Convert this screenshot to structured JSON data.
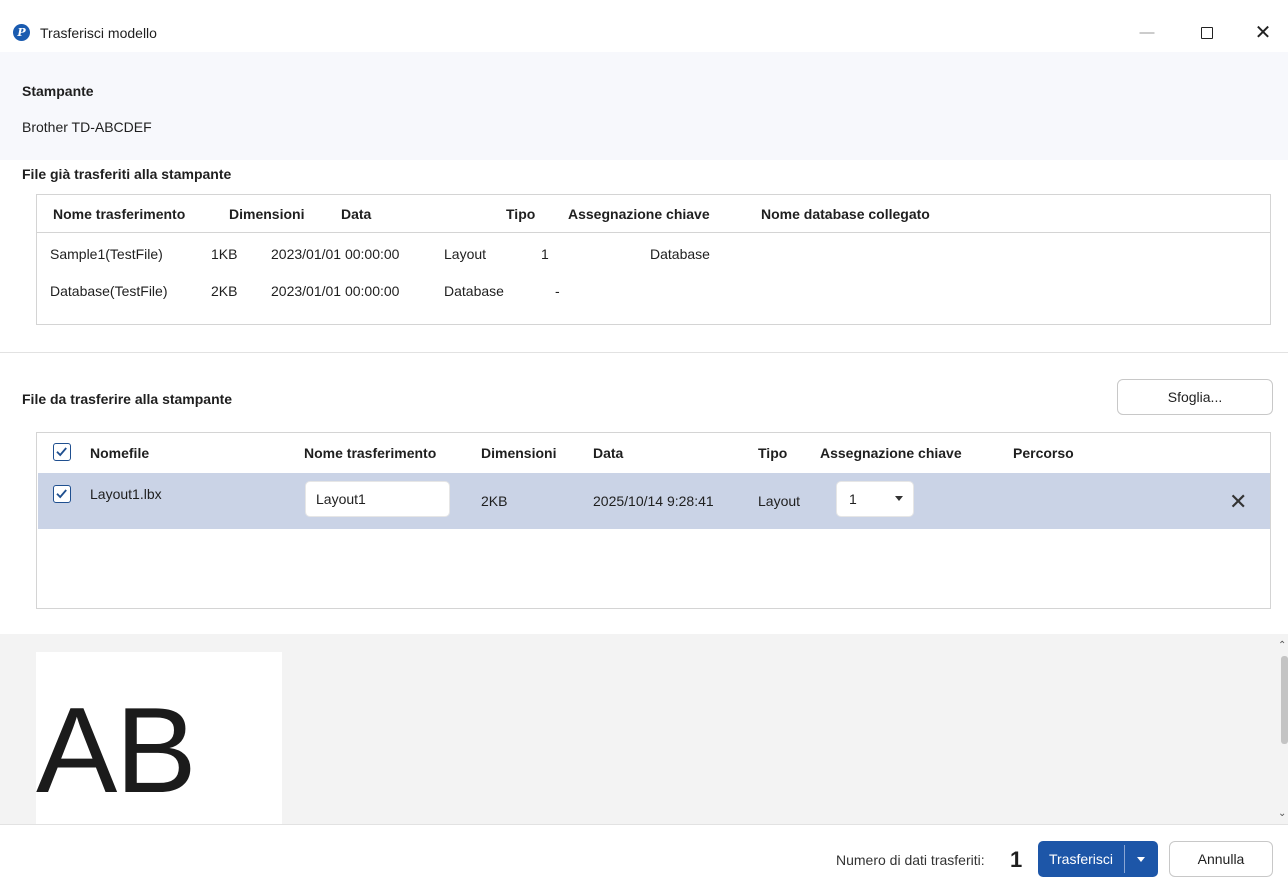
{
  "window": {
    "title": "Trasferisci modello",
    "minimize_glyph": "—",
    "close_glyph": "✕",
    "icon": "brother-p-logo-icon"
  },
  "printer": {
    "label": "Stampante",
    "name": "Brother TD-ABCDEF"
  },
  "transferred": {
    "label": "File già trasferiti alla stampante",
    "headers": {
      "name": "Nome trasferimento",
      "size": "Dimensioni",
      "date": "Data",
      "type": "Tipo",
      "key": "Assegnazione chiave",
      "db": "Nome database collegato"
    },
    "rows": [
      {
        "name": "Sample1(TestFile)",
        "size": "1KB",
        "date": "2023/01/01 00:00:00",
        "type": "Layout",
        "key": "1",
        "db": "Database"
      },
      {
        "name": "Database(TestFile)",
        "size": "2KB",
        "date": "2023/01/01 00:00:00",
        "type": "Database",
        "key": "-",
        "db": ""
      }
    ]
  },
  "to_transfer": {
    "label": "File da trasferire alla stampante",
    "browse_label": "Sfoglia...",
    "headers": {
      "filename": "Nomefile",
      "name": "Nome trasferimento",
      "size": "Dimensioni",
      "date": "Data",
      "type": "Tipo",
      "key": "Assegnazione chiave",
      "path": "Percorso"
    },
    "select_all_checked": true,
    "rows": [
      {
        "checked": true,
        "filename": "Layout1.lbx",
        "name": "Layout1",
        "size": "2KB",
        "date": "2025/10/14 9:28:41",
        "type": "Layout",
        "key": "1",
        "path": "",
        "remove_glyph": "✕"
      }
    ]
  },
  "preview": {
    "text": "AB"
  },
  "footer": {
    "count_label": "Numero di dati trasferiti:",
    "count_value": "1",
    "transfer_label": "Trasferisci",
    "cancel_label": "Annulla"
  },
  "colors": {
    "accent": "#1d56a8",
    "selected_row": "#cad3e6",
    "checkbox_border": "#1f4f8f"
  }
}
